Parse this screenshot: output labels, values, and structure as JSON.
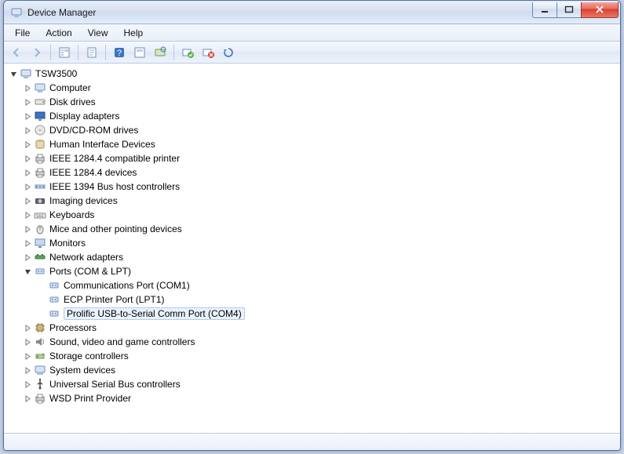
{
  "window": {
    "title": "Device Manager"
  },
  "menu": {
    "file": "File",
    "action": "Action",
    "view": "View",
    "help": "Help"
  },
  "toolbar_icons": {
    "back": "Back",
    "forward": "Forward",
    "show_hidden": "Show hidden devices",
    "properties": "Properties",
    "help": "Help",
    "update": "Update driver",
    "scan": "Scan for hardware changes",
    "uninstall": "Uninstall",
    "disable": "Disable",
    "add_legacy": "Add legacy hardware"
  },
  "tree": {
    "root": {
      "label": "TSW3500",
      "expanded": true
    },
    "nodes": [
      {
        "label": "Computer",
        "icon": "computer"
      },
      {
        "label": "Disk drives",
        "icon": "disk"
      },
      {
        "label": "Display adapters",
        "icon": "display"
      },
      {
        "label": "DVD/CD-ROM drives",
        "icon": "dvd"
      },
      {
        "label": "Human Interface Devices",
        "icon": "hid"
      },
      {
        "label": "IEEE 1284.4 compatible printer",
        "icon": "printer"
      },
      {
        "label": "IEEE 1284.4 devices",
        "icon": "printer"
      },
      {
        "label": "IEEE 1394 Bus host controllers",
        "icon": "bus"
      },
      {
        "label": "Imaging devices",
        "icon": "imaging"
      },
      {
        "label": "Keyboards",
        "icon": "keyboard"
      },
      {
        "label": "Mice and other pointing devices",
        "icon": "mouse"
      },
      {
        "label": "Monitors",
        "icon": "monitor"
      },
      {
        "label": "Network adapters",
        "icon": "network"
      },
      {
        "label": "Ports (COM & LPT)",
        "icon": "port",
        "expanded": true,
        "children": [
          {
            "label": "Communications Port (COM1)",
            "icon": "port"
          },
          {
            "label": "ECP Printer Port (LPT1)",
            "icon": "port"
          },
          {
            "label": "Prolific USB-to-Serial Comm Port (COM4)",
            "icon": "port",
            "selected": true
          }
        ]
      },
      {
        "label": "Processors",
        "icon": "cpu"
      },
      {
        "label": "Sound, video and game controllers",
        "icon": "sound"
      },
      {
        "label": "Storage controllers",
        "icon": "storage"
      },
      {
        "label": "System devices",
        "icon": "system"
      },
      {
        "label": "Universal Serial Bus controllers",
        "icon": "usb"
      },
      {
        "label": "WSD Print Provider",
        "icon": "printer"
      }
    ]
  }
}
